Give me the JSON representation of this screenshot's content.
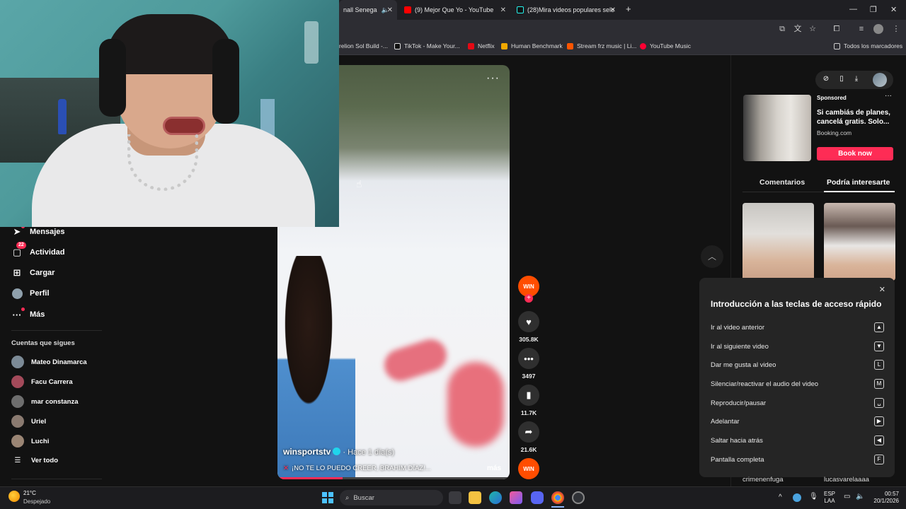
{
  "browser": {
    "tabs": [
      {
        "label": "nall Senega",
        "active": true
      },
      {
        "label": "(9) Mejor Que Yo - YouTube",
        "active": false
      },
      {
        "label": "(28)Mira videos populares sele",
        "active": false
      }
    ],
    "new_tab_label": "+",
    "bookmarks": [
      "relion Sol Build -...",
      "TikTok - Make Your...",
      "Netflix",
      "Human Benchmark",
      "Stream frz music | Li...",
      "YouTube Music"
    ],
    "all_bookmarks": "Todos los marcadores"
  },
  "sidebar": {
    "items": [
      {
        "label": "Mensajes",
        "icon": "send-icon"
      },
      {
        "label": "Actividad",
        "icon": "inbox-icon",
        "badge": "22"
      },
      {
        "label": "Cargar",
        "icon": "upload-icon"
      },
      {
        "label": "Perfil",
        "icon": "profile-icon"
      },
      {
        "label": "Más",
        "icon": "more-icon"
      }
    ],
    "following_title": "Cuentas que sigues",
    "following": [
      "Mateo Dinamarca",
      "Facu Carrera",
      "mar constanza",
      "Uriel",
      "Luchi"
    ],
    "see_all": "Ver todo"
  },
  "video": {
    "author": "winsportstv",
    "time_ago": "· Hace 1 día(s)",
    "caption": "¡NO TE LO PUEDO CREER, BRAHIM DÍAZ!...",
    "more": "más",
    "progress": 0.28
  },
  "actions": {
    "logo_text": "WIN",
    "likes": "305.8K",
    "comments": "3497",
    "saves": "11.7K",
    "shares": "21.6K"
  },
  "ad": {
    "sponsored": "Sponsored",
    "title": "Si cambiás de planes, cancelá gratis. Solo...",
    "source": "Booking.com",
    "button": "Book now"
  },
  "right_tabs": [
    "Comentarios",
    "Podría interesarte"
  ],
  "shortcuts": {
    "title": "Introducción a las teclas de acceso rápido",
    "rows": [
      {
        "label": "Ir al video anterior",
        "key": "▲"
      },
      {
        "label": "Ir al siguiente video",
        "key": "▼"
      },
      {
        "label": "Dar me gusta al video",
        "key": "L"
      },
      {
        "label": "Silenciar/reactivar el audio del video",
        "key": "M"
      },
      {
        "label": "Reproducir/pausar",
        "key": "␣"
      },
      {
        "label": "Adelantar",
        "key": "▶"
      },
      {
        "label": "Saltar hacia atrás",
        "key": "◀"
      },
      {
        "label": "Pantalla completa",
        "key": "F"
      }
    ]
  },
  "below_panel": [
    "crimenenfuga",
    "lucasvarelaaaa"
  ],
  "taskbar": {
    "weather_temp": "21°C",
    "weather_desc": "Despejado",
    "search_placeholder": "Buscar",
    "lang_1": "ESP",
    "lang_2": "LAA",
    "time": "00:57",
    "date": "20/1/2026"
  }
}
